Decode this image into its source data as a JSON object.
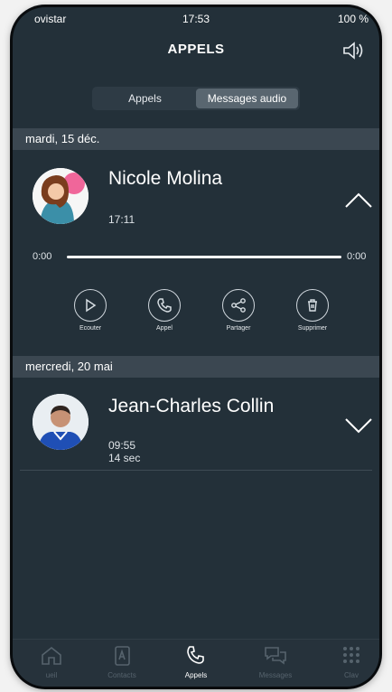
{
  "status_bar": {
    "carrier": "ovistar",
    "time": "17:53",
    "battery": "100 %"
  },
  "header": {
    "title": "APPELS"
  },
  "segments": [
    {
      "label": "Appels",
      "active": false
    },
    {
      "label": "Messages audio",
      "active": true
    }
  ],
  "sections": [
    {
      "date": "mardi, 15 déc.",
      "item": {
        "name": "Nicole Molina",
        "time": "17:11",
        "expanded": true,
        "progress": {
          "start": "0:00",
          "end": "0:00",
          "fraction": 0
        },
        "actions": [
          {
            "label": "Ecouter",
            "icon": "play-icon"
          },
          {
            "label": "Appel",
            "icon": "phone-icon"
          },
          {
            "label": "Partager",
            "icon": "share-icon"
          },
          {
            "label": "Supprimer",
            "icon": "trash-icon"
          }
        ]
      }
    },
    {
      "date": "mercredi, 20 mai",
      "item": {
        "name": "Jean-Charles Collin",
        "time": "09:55",
        "duration": "14 sec",
        "expanded": false
      }
    }
  ],
  "tab_bar": {
    "items": [
      {
        "label": "ueil",
        "icon": "home-icon"
      },
      {
        "label": "Contacts",
        "icon": "contacts-icon"
      },
      {
        "label": "Appels",
        "icon": "phone-icon",
        "active": true
      },
      {
        "label": "Messages",
        "icon": "chat-icon"
      },
      {
        "label": "Clav",
        "icon": "keypad-icon"
      }
    ]
  }
}
